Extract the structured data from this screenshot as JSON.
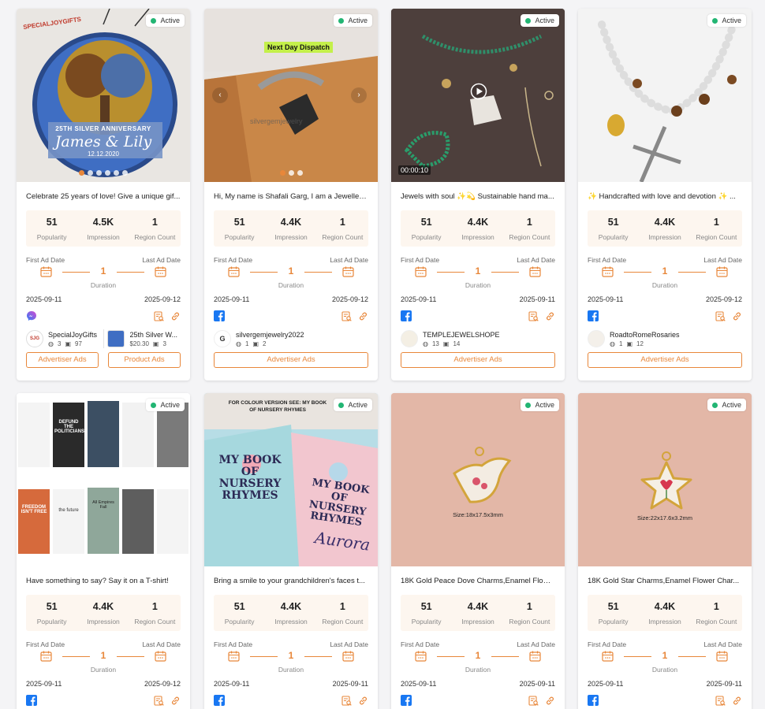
{
  "cards": [
    {
      "status": "Active",
      "caption": "Celebrate 25 years of love! Give a unique gif...",
      "popularity": "51",
      "impression": "4.5K",
      "region": "1",
      "metric_labels": {
        "popularity": "Popularity",
        "impression": "Impression",
        "region": "Region Count"
      },
      "first_label": "First Ad Date",
      "last_label": "Last Ad Date",
      "duration": "1",
      "duration_label": "Duration",
      "first_date": "2025-09-11",
      "last_date": "2025-09-12",
      "platform": "messenger-icon",
      "image_text": {
        "brand": "SPECIALJOYGIFTS",
        "line1": "25TH SILVER ANNIVERSARY",
        "line2": "James & Lily",
        "line3": "12.12.2020"
      },
      "advertiser": {
        "name": "SpecialJoyGifts",
        "s1": "3",
        "s2": "97"
      },
      "product": {
        "name": "25th Silver W...",
        "price": "$20.30",
        "s2": "3"
      },
      "btn1": "Advertiser Ads",
      "btn2": "Product Ads"
    },
    {
      "status": "Active",
      "caption": "Hi, My name is Shafali Garg, I am a Jewellery...",
      "popularity": "51",
      "impression": "4.4K",
      "region": "1",
      "metric_labels": {
        "popularity": "Popularity",
        "impression": "Impression",
        "region": "Region Count"
      },
      "first_label": "First Ad Date",
      "last_label": "Last Ad Date",
      "duration": "1",
      "duration_label": "Duration",
      "first_date": "2025-09-11",
      "last_date": "2025-09-12",
      "platform": "facebook-icon",
      "image_text": {
        "tag": "Next Day Dispatch",
        "wm": "silvergemjewelry"
      },
      "advertiser": {
        "name": "silvergemjewelry2022",
        "s1": "1",
        "s2": "2"
      },
      "btn1": "Advertiser Ads"
    },
    {
      "status": "Active",
      "caption": "Jewels with soul ✨💫 Sustainable hand ma...",
      "popularity": "51",
      "impression": "4.4K",
      "region": "1",
      "metric_labels": {
        "popularity": "Popularity",
        "impression": "Impression",
        "region": "Region Count"
      },
      "first_label": "First Ad Date",
      "last_label": "Last Ad Date",
      "duration": "1",
      "duration_label": "Duration",
      "first_date": "2025-09-11",
      "last_date": "2025-09-11",
      "platform": "facebook-icon",
      "video_time": "00:00:10",
      "advertiser": {
        "name": "TEMPLEJEWELSHOPE",
        "s1": "13",
        "s2": "14"
      },
      "btn1": "Advertiser Ads"
    },
    {
      "status": "Active",
      "caption": "✨ Handcrafted with love and devotion ✨ ...",
      "popularity": "51",
      "impression": "4.4K",
      "region": "1",
      "metric_labels": {
        "popularity": "Popularity",
        "impression": "Impression",
        "region": "Region Count"
      },
      "first_label": "First Ad Date",
      "last_label": "Last Ad Date",
      "duration": "1",
      "duration_label": "Duration",
      "first_date": "2025-09-11",
      "last_date": "2025-09-12",
      "platform": "facebook-icon",
      "advertiser": {
        "name": "RoadtoRomeRosaries",
        "s1": "1",
        "s2": "12"
      },
      "btn1": "Advertiser Ads"
    },
    {
      "status": "Active",
      "caption": "Have something to say? Say it on a T-shirt!",
      "popularity": "51",
      "impression": "4.4K",
      "region": "1",
      "metric_labels": {
        "popularity": "Popularity",
        "impression": "Impression",
        "region": "Region Count"
      },
      "first_label": "First Ad Date",
      "last_label": "Last Ad Date",
      "duration": "1",
      "duration_label": "Duration",
      "first_date": "2025-09-11",
      "last_date": "2025-09-12",
      "platform": "facebook-icon",
      "image_text": {
        "t1": "DEFUND THE POLITICIANS",
        "t2": "FREEDOM ISN'T FREE",
        "t3": "the future",
        "t4": "All Empires Fall"
      }
    },
    {
      "status": "Active",
      "caption": "Bring a smile to your grandchildren's faces t...",
      "popularity": "51",
      "impression": "4.4K",
      "region": "1",
      "metric_labels": {
        "popularity": "Popularity",
        "impression": "Impression",
        "region": "Region Count"
      },
      "first_label": "First Ad Date",
      "last_label": "Last Ad Date",
      "duration": "1",
      "duration_label": "Duration",
      "first_date": "2025-09-11",
      "last_date": "2025-09-11",
      "platform": "facebook-icon",
      "image_text": {
        "top": "FOR COLOUR VERSION SEE: MY BOOK OF NURSERY RHYMES",
        "book": "MY BOOK OF NURSERY RHYMES",
        "name": "Aurora"
      }
    },
    {
      "status": "Active",
      "caption": "18K Gold Peace Dove Charms,Enamel Flowe...",
      "popularity": "51",
      "impression": "4.4K",
      "region": "1",
      "metric_labels": {
        "popularity": "Popularity",
        "impression": "Impression",
        "region": "Region Count"
      },
      "first_label": "First Ad Date",
      "last_label": "Last Ad Date",
      "duration": "1",
      "duration_label": "Duration",
      "first_date": "2025-09-11",
      "last_date": "2025-09-11",
      "platform": "facebook-icon",
      "image_text": {
        "size": "Size:18x17.5x3mm"
      }
    },
    {
      "status": "Active",
      "caption": "18K Gold Star Charms,Enamel Flower Char...",
      "popularity": "51",
      "impression": "4.4K",
      "region": "1",
      "metric_labels": {
        "popularity": "Popularity",
        "impression": "Impression",
        "region": "Region Count"
      },
      "first_label": "First Ad Date",
      "last_label": "Last Ad Date",
      "duration": "1",
      "duration_label": "Duration",
      "first_date": "2025-09-11",
      "last_date": "2025-09-11",
      "platform": "facebook-icon",
      "image_text": {
        "size": "Size:22x17.6x3.2mm"
      }
    }
  ]
}
